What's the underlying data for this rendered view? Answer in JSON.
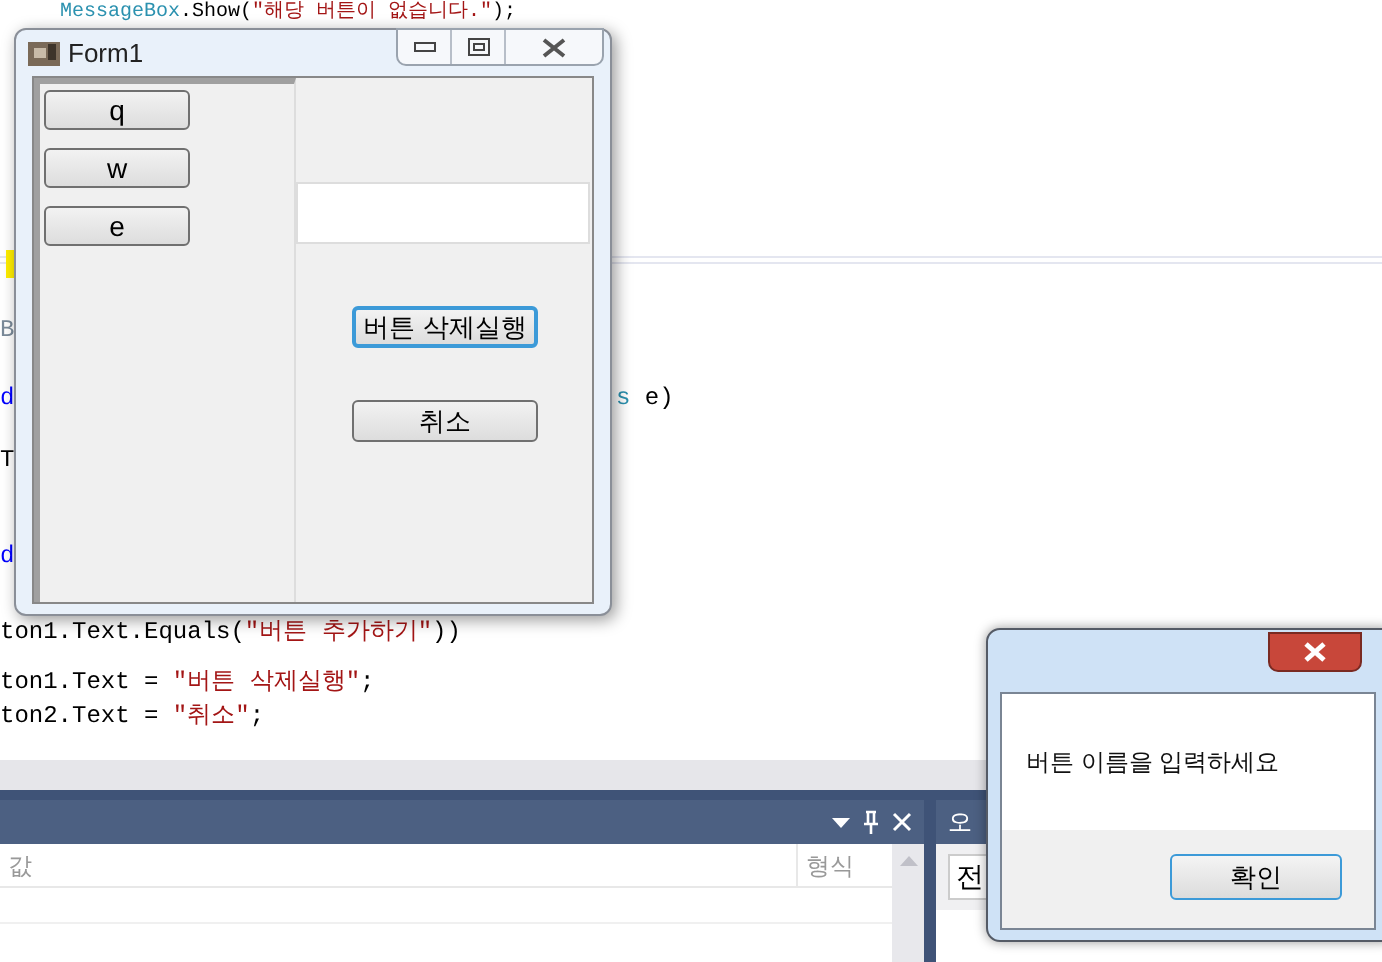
{
  "code_lines": [
    {
      "top": [
        {
          "t": "MessageBox",
          "kind": "type"
        },
        {
          "t": ".Show(",
          "kind": "plain"
        },
        {
          "t": "\"해당 버튼이 없습니다.\"",
          "kind": "string"
        },
        {
          "t": ");",
          "kind": "plain"
        }
      ]
    },
    {
      "left": [
        {
          "t": "B",
          "kind": "comment"
        }
      ]
    },
    {
      "left": [
        {
          "t": "d",
          "kind": "keyword"
        }
      ],
      "right": [
        {
          "t": "s",
          "kind": "type"
        },
        {
          "t": " e)",
          "kind": "plain"
        }
      ]
    },
    {
      "left": [
        {
          "t": "T",
          "kind": "plain"
        }
      ]
    },
    {
      "left": [
        {
          "t": "d",
          "kind": "keyword"
        }
      ]
    },
    {
      "left": [
        {
          "t": "ton1.Text.Equals(",
          "kind": "plain"
        },
        {
          "t": "\"버튼 추가하기\"",
          "kind": "string"
        },
        {
          "t": "))",
          "kind": "plain"
        }
      ]
    },
    {
      "left": [
        {
          "t": "ton1.Text = ",
          "kind": "plain"
        },
        {
          "t": "\"버튼 삭제실행\"",
          "kind": "string"
        },
        {
          "t": ";",
          "kind": "plain"
        }
      ]
    },
    {
      "left": [
        {
          "t": "ton2.Text = ",
          "kind": "plain"
        },
        {
          "t": "\"취소\"",
          "kind": "string"
        },
        {
          "t": ";",
          "kind": "plain"
        }
      ]
    }
  ],
  "form": {
    "title": "Form1",
    "left_buttons": [
      "q",
      "w",
      "e"
    ],
    "buttons": [
      {
        "label": "버튼 삭제실행",
        "focused": true
      },
      {
        "label": "취소",
        "focused": false
      }
    ]
  },
  "message_box": {
    "message": "버튼 이름을 입력하세요",
    "ok_button": "확인"
  },
  "watch_panel": {
    "columns": [
      "값",
      "형식"
    ]
  },
  "error_panel": {
    "title": "오",
    "toolbar_item": "전"
  }
}
